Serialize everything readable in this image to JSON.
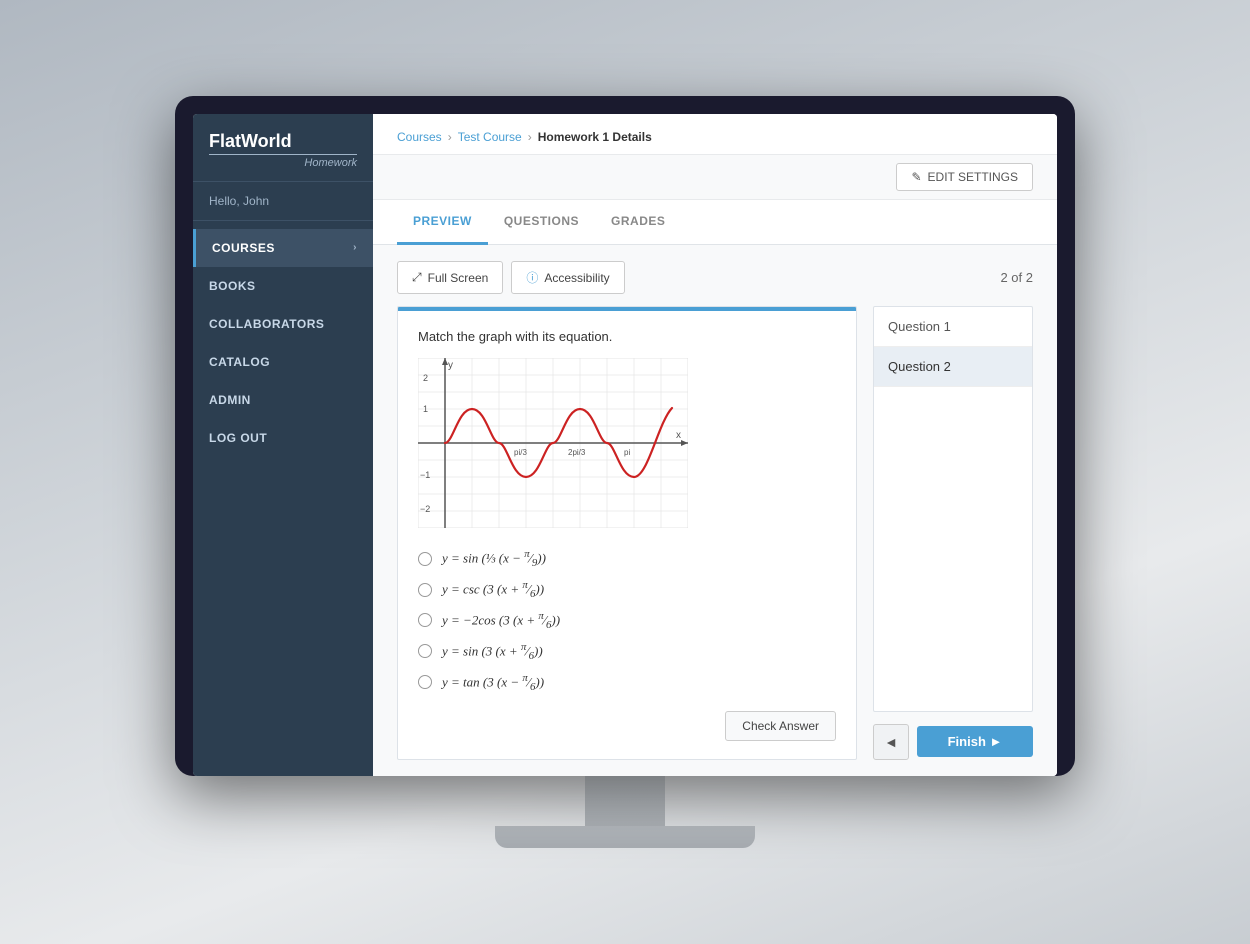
{
  "app": {
    "logo_title": "FlatWorld",
    "logo_subtitle": "Homework",
    "user_greeting": "Hello, John"
  },
  "sidebar": {
    "nav_items": [
      {
        "id": "courses",
        "label": "COURSES",
        "active": true,
        "has_chevron": true
      },
      {
        "id": "books",
        "label": "BOOKS",
        "active": false,
        "has_chevron": false
      },
      {
        "id": "collaborators",
        "label": "COLLABORATORS",
        "active": false,
        "has_chevron": false
      },
      {
        "id": "catalog",
        "label": "CATALOG",
        "active": false,
        "has_chevron": false
      },
      {
        "id": "admin",
        "label": "ADMIN",
        "active": false,
        "has_chevron": false
      },
      {
        "id": "logout",
        "label": "LOG OUT",
        "active": false,
        "has_chevron": false
      }
    ]
  },
  "breadcrumb": {
    "items": [
      {
        "label": "Courses",
        "current": false
      },
      {
        "label": "Test Course",
        "current": false
      },
      {
        "label": "Homework 1 Details",
        "current": true
      }
    ]
  },
  "toolbar": {
    "edit_settings_label": "EDIT SETTINGS",
    "edit_icon": "✎"
  },
  "tabs": [
    {
      "id": "preview",
      "label": "PREVIEW",
      "active": true
    },
    {
      "id": "questions",
      "label": "QUESTIONS",
      "active": false
    },
    {
      "id": "grades",
      "label": "GRADES",
      "active": false
    }
  ],
  "content_toolbar": {
    "full_screen_label": "Full Screen",
    "accessibility_label": "Accessibility",
    "full_screen_icon": "⤢",
    "accessibility_icon": "ⓘ"
  },
  "question": {
    "page_counter": "2 of 2",
    "prompt": "Match the graph with its equation.",
    "choices": [
      {
        "id": "a",
        "formula_html": "y = sin (⅓ (x − π/9))"
      },
      {
        "id": "b",
        "formula_html": "y = csc (3 (x + π/6))"
      },
      {
        "id": "c",
        "formula_html": "y = −2cos (3 (x + π/6))"
      },
      {
        "id": "d",
        "formula_html": "y = sin (3 (x + π/6))"
      },
      {
        "id": "e",
        "formula_html": "y = tan (3 (x − π/6))"
      }
    ],
    "check_answer_label": "Check Answer"
  },
  "question_list": {
    "items": [
      {
        "label": "Question 1",
        "active": false
      },
      {
        "label": "Question 2",
        "active": true
      }
    ]
  },
  "navigation": {
    "prev_icon": "◄",
    "finish_label": "Finish ►"
  }
}
